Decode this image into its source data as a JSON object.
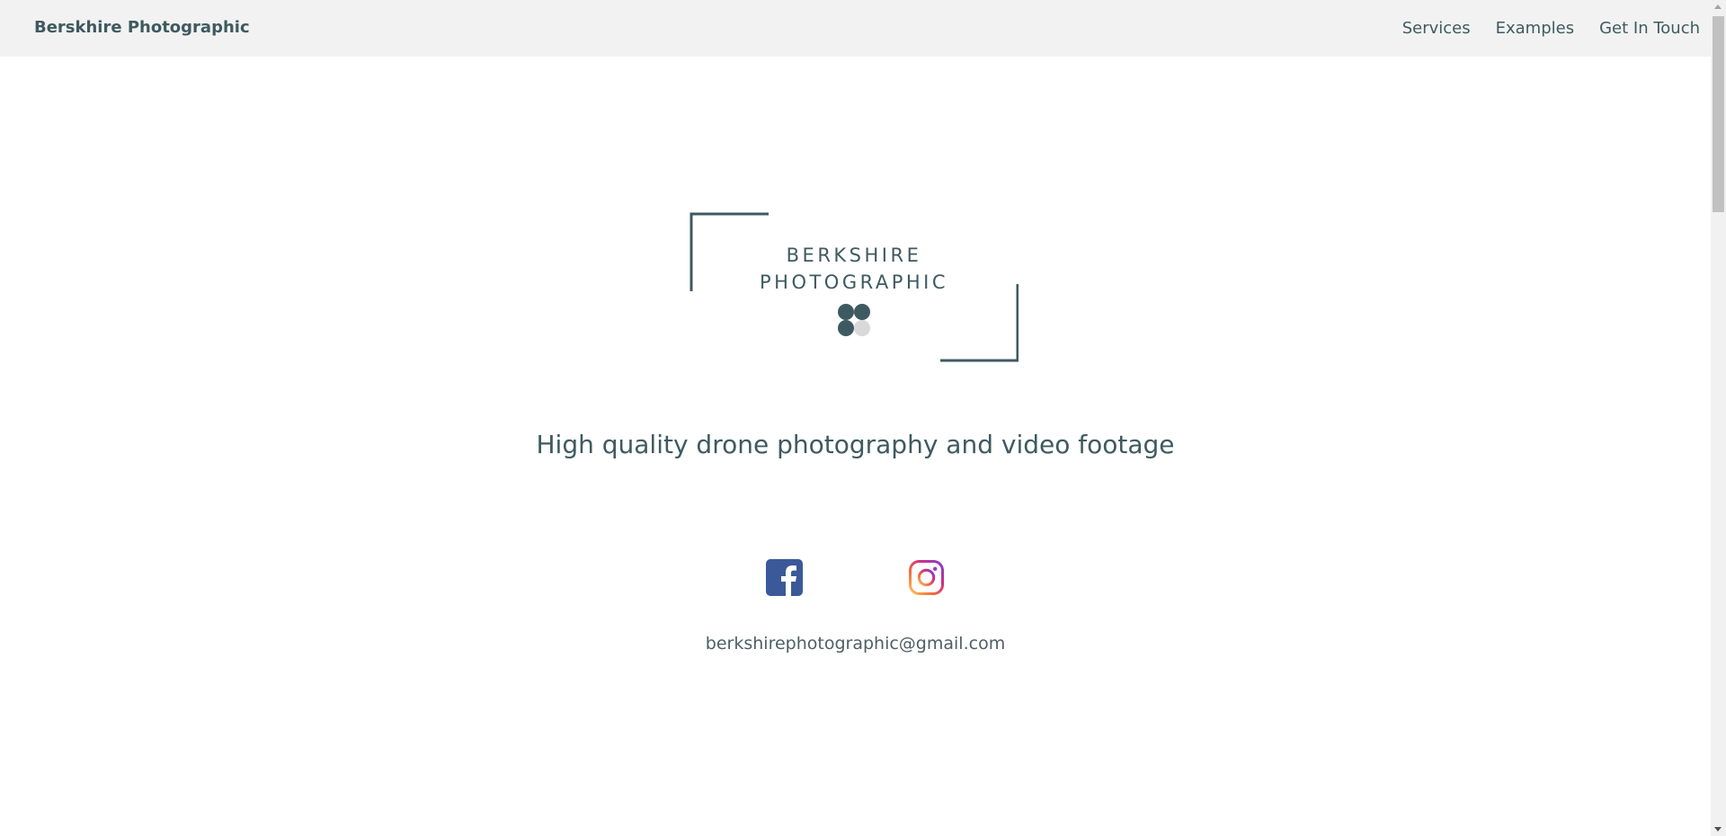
{
  "nav": {
    "brand": "Berskhire Photographic",
    "links": [
      {
        "label": "Services"
      },
      {
        "label": "Examples"
      },
      {
        "label": "Get In Touch"
      }
    ]
  },
  "logo": {
    "line1": "BERKSHIRE",
    "line2": "PHOTOGRAPHIC"
  },
  "hero": {
    "tagline": "High quality drone photography and video footage"
  },
  "social": {
    "facebook_icon": "facebook-icon",
    "instagram_icon": "instagram-icon"
  },
  "contact": {
    "email": "berkshirephotographic@gmail.com"
  },
  "colors": {
    "primary_text": "#3e5a60",
    "nav_background": "#f2f2f2",
    "facebook_blue": "#3b5998"
  }
}
